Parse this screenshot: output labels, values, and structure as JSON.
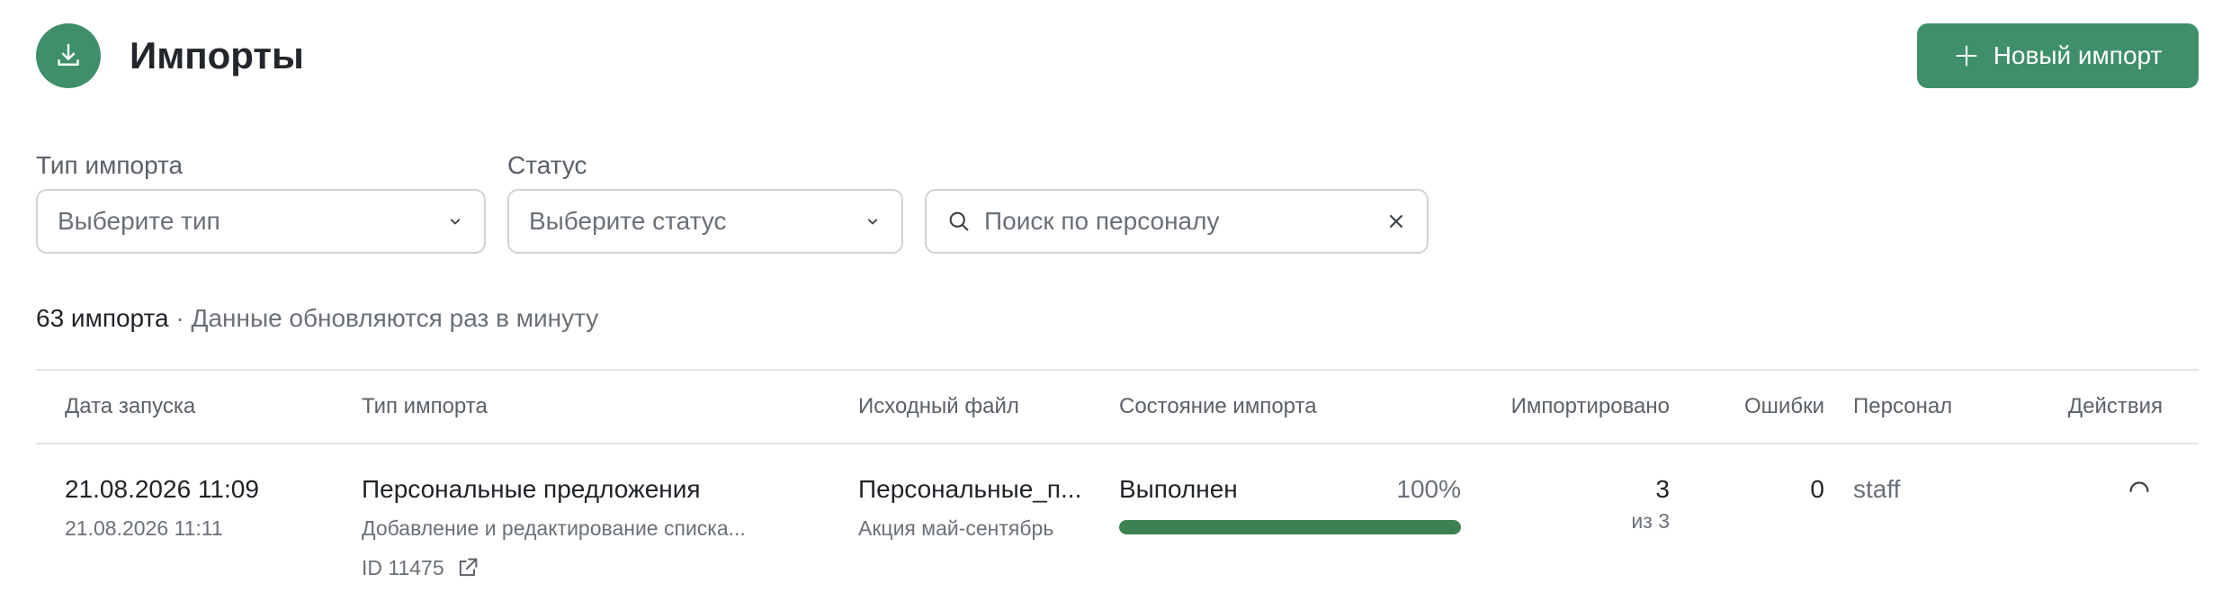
{
  "header": {
    "icon": "download-icon",
    "title": "Импорты",
    "new_import_label": "Новый импорт",
    "accent_color": "#3f8f6a"
  },
  "filters": {
    "type": {
      "label": "Тип импорта",
      "value": "Выберите тип"
    },
    "status": {
      "label": "Статус",
      "value": "Выберите статус"
    },
    "search": {
      "placeholder": "Поиск по персоналу",
      "value": ""
    }
  },
  "summary": {
    "count_text": "63 импорта",
    "note_text": " · Данные обновляются раз в минуту"
  },
  "table": {
    "columns": {
      "date": "Дата запуска",
      "type": "Тип импорта",
      "file": "Исходный файл",
      "state": "Состояние импорта",
      "imported": "Импортировано",
      "errors": "Ошибки",
      "staff": "Персонал",
      "actions": "Действия"
    },
    "rows": [
      {
        "date_start": "21.08.2026 11:09",
        "date_end": "21.08.2026 11:11",
        "type_title": "Персональные предложения",
        "type_desc": "Добавление и редактирование списка...",
        "id_text": "ID 11475",
        "file_name": "Персональные_п...",
        "file_desc": "Акция май-сентябрь",
        "state_text": "Выполнен",
        "progress_text": "100%",
        "progress": 100,
        "progress_color": "#3c8150",
        "imported_count": "3",
        "imported_total": "из 3",
        "errors": "0",
        "staff": "staff"
      }
    ]
  }
}
